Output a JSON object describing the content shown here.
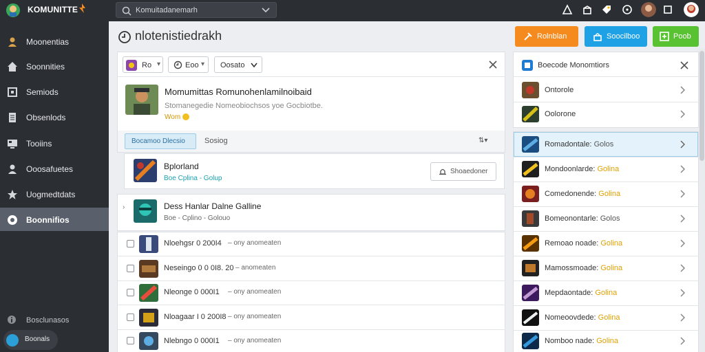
{
  "topbar": {
    "brand": "KOMUNITTE",
    "search_placeholder": "Komuitadanemarh"
  },
  "sidebar": {
    "items": [
      {
        "label": "Moonentias",
        "icon": "user-icon"
      },
      {
        "label": "Soonnities",
        "icon": "home-icon"
      },
      {
        "label": "Semiods",
        "icon": "square-icon"
      },
      {
        "label": "Obsenlods",
        "icon": "document-icon"
      },
      {
        "label": "Tooiins",
        "icon": "monitor-icon"
      },
      {
        "label": "Ooosafuetes",
        "icon": "people-icon"
      },
      {
        "label": "Uogmedtdats",
        "icon": "star-icon"
      },
      {
        "label": "Boonnifios",
        "icon": "circle-icon",
        "active": true
      }
    ],
    "footer_label": "Bosclunasos",
    "chip_label": "Boonals"
  },
  "header": {
    "title": "nlotenistiedrakh",
    "buttons": [
      {
        "label": "Rolnblan",
        "color": "#f58a1f"
      },
      {
        "label": "Soocilboo",
        "color": "#1fa1e6"
      },
      {
        "label": "Poob",
        "color": "#58c233"
      }
    ]
  },
  "filters": {
    "chip1": "Ro",
    "chip2": "Eoo",
    "chip3": "Oosato"
  },
  "featured": {
    "title": "Momumittas Romunohenlamilnoibaid",
    "subtitle": "Stomanegedie Nomeobiochsos yoe Gocbiotbe.",
    "meta": "Wom"
  },
  "tabs": {
    "active": "Bocamoo Dlecsio",
    "second": "Sosiog"
  },
  "card": {
    "title": "Bplorland",
    "meta": "Boe Cplina - Golup",
    "action": "Shoaedoner"
  },
  "highlight": {
    "title": "Dess Hanlar Dalne Galline",
    "meta": "Boe - Cplino - Golouo"
  },
  "rows": [
    {
      "title": "Nloehgsr 0 200I4",
      "meta": "– ony anomeaten"
    },
    {
      "title": "Neseingo 0 0 0I8. 20",
      "meta": "– anomeaten"
    },
    {
      "title": "Nleonge 0 000I1",
      "meta": "– ony anomeaten"
    },
    {
      "title": "Nloagaar I 0 200I8",
      "meta": "– ony anomeaten"
    },
    {
      "title": "Nlebngo 0 000I1",
      "meta": "– ony anomeaten"
    }
  ],
  "right_panel": {
    "title": "Boecode Monomtiors",
    "top_items": [
      "Ontorole",
      "Oolorone"
    ],
    "items": [
      {
        "label": "Romadontale:",
        "accent": "Golos",
        "selected": true
      },
      {
        "label": "Mondoonlarde:",
        "accent": "Golina"
      },
      {
        "label": "Comedonende:",
        "accent": "Golina"
      },
      {
        "label": "Bomeonontarle:",
        "accent": "Golos"
      },
      {
        "label": "Remoao noade:",
        "accent": "Golina"
      },
      {
        "label": "Mamossmoade:",
        "accent": "Golina"
      },
      {
        "label": "Mepdaontade:",
        "accent": "Golina"
      },
      {
        "label": "Nomeoovdede:",
        "accent": "Golina"
      },
      {
        "label": "Nomboo nade:",
        "accent": "Golina"
      }
    ]
  },
  "colors": {
    "accent": "#e0a000",
    "selected_bg": "#e4f3fb"
  }
}
